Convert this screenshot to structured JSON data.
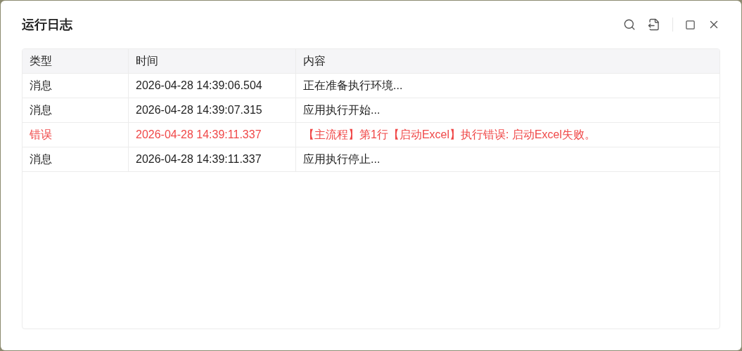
{
  "window": {
    "title": "运行日志"
  },
  "table": {
    "columns": [
      "类型",
      "时间",
      "内容"
    ],
    "rows": [
      {
        "kind": "message",
        "cells": [
          "消息",
          "2026-04-28 14:39:06.504",
          "正在准备执行环境..."
        ]
      },
      {
        "kind": "message",
        "cells": [
          "消息",
          "2026-04-28 14:39:07.315",
          "应用执行开始..."
        ]
      },
      {
        "kind": "error",
        "cells": [
          "错误",
          "2026-04-28 14:39:11.337",
          "【主流程】第1行【启动Excel】执行错误: 启动Excel失败。"
        ]
      },
      {
        "kind": "message",
        "cells": [
          "消息",
          "2026-04-28 14:39:11.337",
          "应用执行停止..."
        ]
      }
    ]
  }
}
